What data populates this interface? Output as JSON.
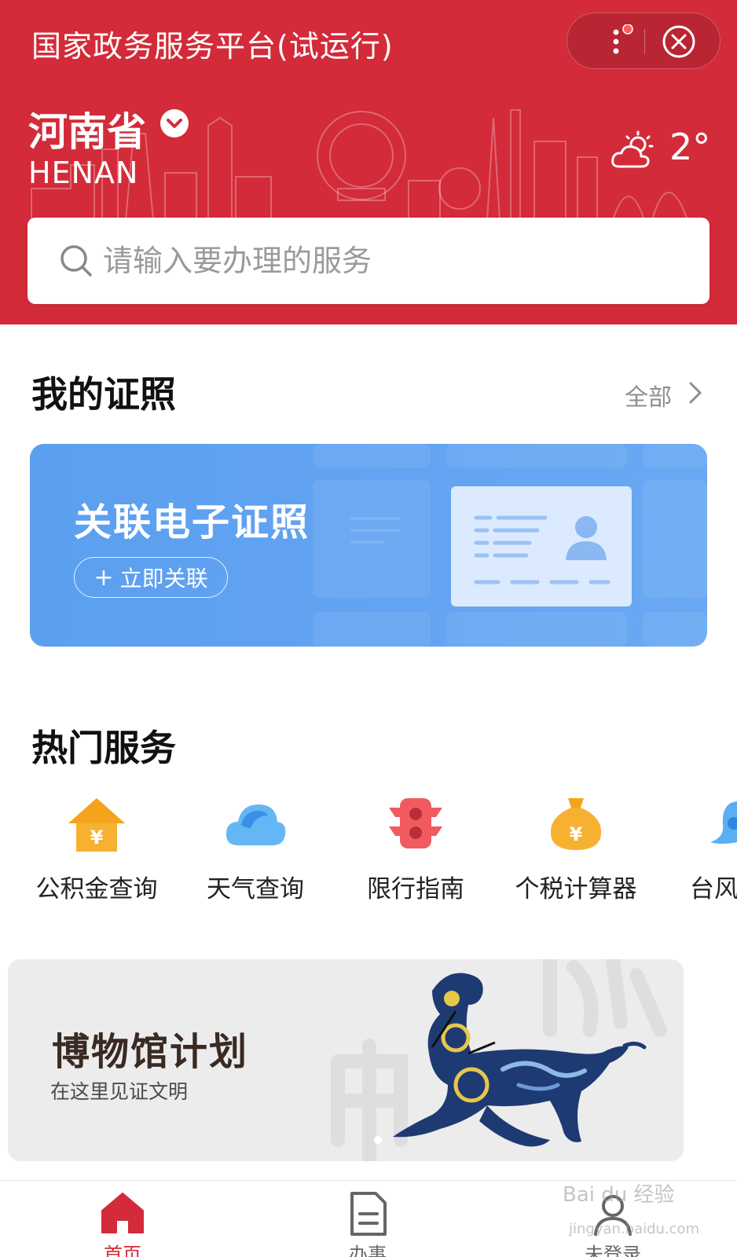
{
  "header": {
    "app_title": "国家政务服务平台(试运行)",
    "province": "河南省",
    "province_en": "HENAN",
    "temperature": "2°",
    "weather_icon": "partly-cloudy-icon",
    "brand_color": "#d32b39"
  },
  "search": {
    "placeholder": "请输入要办理的服务"
  },
  "certificates": {
    "title": "我的证照",
    "view_all": "全部",
    "card_title": "关联电子证照",
    "link_button": "立即关联",
    "link_plus": "+"
  },
  "hot_services": {
    "title": "热门服务",
    "items": [
      {
        "label": "公积金查询",
        "icon": "house-fund-icon"
      },
      {
        "label": "天气查询",
        "icon": "weather-cloud-icon"
      },
      {
        "label": "限行指南",
        "icon": "traffic-light-icon"
      },
      {
        "label": "个税计算器",
        "icon": "money-bag-icon"
      },
      {
        "label": "台风",
        "icon": "typhoon-icon"
      }
    ]
  },
  "banner": {
    "title": "博物馆计划",
    "subtitle": "在这里见证文明"
  },
  "tabbar": {
    "items": [
      {
        "label": "首页",
        "icon": "home-icon",
        "active": true
      },
      {
        "label": "办事",
        "icon": "document-icon",
        "active": false
      },
      {
        "label": "未登录",
        "icon": "user-icon",
        "active": false
      }
    ],
    "active_color": "#d32b39",
    "inactive_color": "#666666"
  },
  "watermark": {
    "text": "Bai du 经验",
    "url_text": "jingyan.baidu.com"
  }
}
